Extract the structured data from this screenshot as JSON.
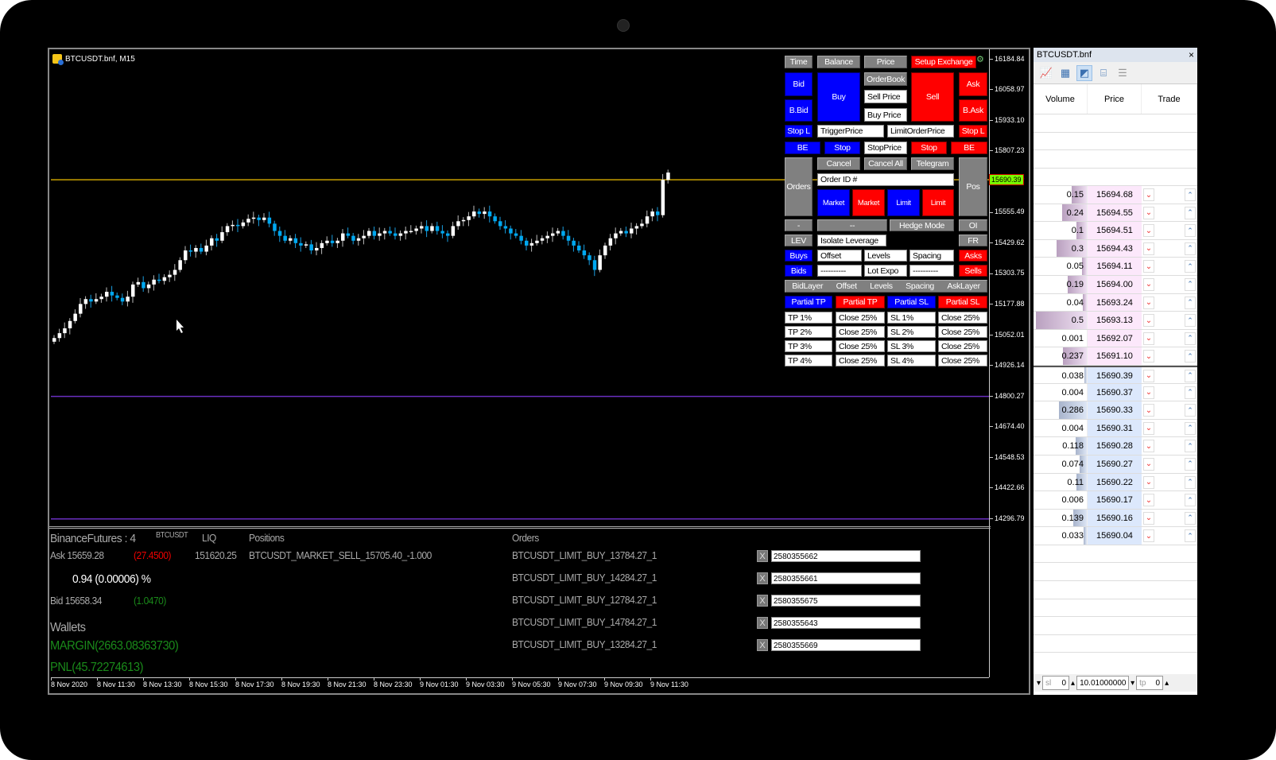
{
  "window": {
    "title": "BTCUSDT.bnf, M15"
  },
  "chart_data": {
    "type": "candlestick",
    "symbol": "BTCUSDT.bnf",
    "timeframe": "M15",
    "y_ticks": [
      "16184.84",
      "16058.97",
      "15933.10",
      "15807.23",
      "15690.39",
      "15555.49",
      "15429.62",
      "15303.75",
      "15177.88",
      "15052.01",
      "14926.14",
      "14800.27",
      "14674.40",
      "14548.53",
      "14422.66",
      "14296.79"
    ],
    "ylim": [
      14260,
      16220
    ],
    "current_price": "15690.39",
    "x_ticks": [
      "8 Nov 2020",
      "8 Nov 11:30",
      "8 Nov 13:30",
      "8 Nov 15:30",
      "8 Nov 17:30",
      "8 Nov 19:30",
      "8 Nov 21:30",
      "8 Nov 23:30",
      "9 Nov 01:30",
      "9 Nov 03:30",
      "9 Nov 05:30",
      "9 Nov 07:30",
      "9 Nov 09:30",
      "9 Nov 11:30"
    ],
    "hlines": [
      {
        "price": 15690.39,
        "color": "#c8a000"
      },
      {
        "price": 14800.27,
        "color": "#6a2fc0"
      },
      {
        "price": 14296.79,
        "color": "#6a2fc0"
      }
    ],
    "candles_close": [
      15040,
      15060,
      15080,
      15110,
      15140,
      15180,
      15200,
      15190,
      15200,
      15210,
      15230,
      15215,
      15205,
      15190,
      15210,
      15260,
      15270,
      15245,
      15260,
      15280,
      15275,
      15290,
      15300,
      15320,
      15360,
      15400,
      15395,
      15410,
      15395,
      15420,
      15450,
      15440,
      15475,
      15500,
      15505,
      15500,
      15515,
      15530,
      15535,
      15525,
      15535,
      15510,
      15480,
      15460,
      15440,
      15450,
      15430,
      15420,
      15425,
      15400,
      15410,
      15430,
      15440,
      15430,
      15440,
      15470,
      15460,
      15440,
      15450,
      15460,
      15480,
      15460,
      15470,
      15480,
      15470,
      15460,
      15470,
      15480,
      15480,
      15490,
      15500,
      15480,
      15500,
      15480,
      15470,
      15460,
      15500,
      15520,
      15525,
      15540,
      15560,
      15550,
      15560,
      15540,
      15520,
      15500,
      15490,
      15470,
      15460,
      15440,
      15420,
      15430,
      15440,
      15450,
      15460,
      15470,
      15480,
      15460,
      15440,
      15420,
      15400,
      15380,
      15360,
      15320,
      15380,
      15420,
      15450,
      15470,
      15480,
      15470,
      15490,
      15500,
      15510,
      15540,
      15560,
      15545,
      15690,
      15720
    ]
  },
  "panel": {
    "top_row": [
      "Time",
      "Balance",
      "Price",
      "Setup Exchange"
    ],
    "bid": "Bid",
    "bbid": "B.Bid",
    "buy": "Buy",
    "orderbook": "OrderBook",
    "sell_price": "Sell Price",
    "buy_price": "Buy Price",
    "sell": "Sell",
    "ask": "Ask",
    "bask": "B.Ask",
    "stopl_left": "Stop L",
    "trigger_price": "TriggerPrice",
    "limit_order_price": "LimitOrderPrice",
    "stopl_right": "Stop L",
    "be_left": "BE",
    "stop_blue": "Stop",
    "stop_price": "StopPrice",
    "stop_red": "Stop",
    "be_right": "BE",
    "orders": "Orders",
    "cancel": "Cancel",
    "cancel_all": "Cancel All",
    "telegram": "Telegram",
    "order_id": "Order ID #",
    "pos": "Pos",
    "market_buy": "Market",
    "market_sell": "Market",
    "limit_buy": "Limit",
    "limit_sell": "Limit",
    "minus": "-",
    "dashes": "--",
    "hedge_mode": "Hedge Mode",
    "oi": "OI",
    "lev": "LEV",
    "isolate_leverage": "Isolate Leverage",
    "fr": "FR",
    "buys": "Buys",
    "offset": "Offset",
    "levels": "Levels",
    "spacing": "Spacing",
    "asks": "Asks",
    "bids": "Bids",
    "blank1": "----------",
    "lot_expo": "Lot Expo",
    "blank2": "----------",
    "sells": "Sells",
    "layer_row": [
      "BidLayer",
      "Offset",
      "Levels",
      "Spacing",
      "AskLayer"
    ],
    "partial": [
      "Partial TP",
      "Partial TP",
      "Partial SL",
      "Partial SL"
    ],
    "tp_rows": [
      [
        "TP 1%",
        "Close 25%",
        "SL 1%",
        "Close 25%"
      ],
      [
        "TP 2%",
        "Close 25%",
        "SL 2%",
        "Close 25%"
      ],
      [
        "TP 3%",
        "Close 25%",
        "SL 3%",
        "Close 25%"
      ],
      [
        "TP 4%",
        "Close 25%",
        "SL 4%",
        "Close 25%"
      ]
    ]
  },
  "info": {
    "exchange": "BinanceFutures : 4",
    "symbol": "BTCUSDT",
    "liq_label": "LIQ",
    "positions_label": "Positions",
    "ask": "Ask 15659.28",
    "ask_change": "(27.4500)",
    "liq_value": "151620.25",
    "position": "BTCUSDT_MARKET_SELL_15705.40_-1.000",
    "spread": "0.94 (0.00006) %",
    "bid": "Bid 15658.34",
    "bid_change": "(1.0470)",
    "wallets": "Wallets",
    "margin": "MARGIN(2663.08363730)",
    "pnl": "PNL(45.72274613)",
    "orders_label": "Orders",
    "orders": [
      {
        "name": "BTCUSDT_LIMIT_BUY_13784.27_1",
        "id": "2580355662"
      },
      {
        "name": "BTCUSDT_LIMIT_BUY_14284.27_1",
        "id": "2580355661"
      },
      {
        "name": "BTCUSDT_LIMIT_BUY_12784.27_1",
        "id": "2580355675"
      },
      {
        "name": "BTCUSDT_LIMIT_BUY_14784.27_1",
        "id": "2580355643"
      },
      {
        "name": "BTCUSDT_LIMIT_BUY_13284.27_1",
        "id": "2580355669"
      }
    ],
    "x_label": "X"
  },
  "dom": {
    "title": "BTCUSDT.bnf",
    "close": "×",
    "headers": [
      "Volume",
      "Price",
      "Trade"
    ],
    "asks": [
      {
        "vol": "0.15",
        "price": "15694.68",
        "frac": 0.3
      },
      {
        "vol": "0.24",
        "price": "15694.55",
        "frac": 0.48
      },
      {
        "vol": "0.1",
        "price": "15694.51",
        "frac": 0.2
      },
      {
        "vol": "0.3",
        "price": "15694.43",
        "frac": 0.6
      },
      {
        "vol": "0.05",
        "price": "15694.11",
        "frac": 0.1
      },
      {
        "vol": "0.19",
        "price": "15694.00",
        "frac": 0.38
      },
      {
        "vol": "0.04",
        "price": "15693.24",
        "frac": 0.08
      },
      {
        "vol": "0.5",
        "price": "15693.13",
        "frac": 1.0
      },
      {
        "vol": "0.001",
        "price": "15692.07",
        "frac": 0.0
      },
      {
        "vol": "0.237",
        "price": "15691.10",
        "frac": 0.47
      }
    ],
    "bids": [
      {
        "vol": "0.038",
        "price": "15690.39",
        "frac": 0.05
      },
      {
        "vol": "0.004",
        "price": "15690.37",
        "frac": 0.0
      },
      {
        "vol": "0.286",
        "price": "15690.33",
        "frac": 0.55
      },
      {
        "vol": "0.004",
        "price": "15690.31",
        "frac": 0.0
      },
      {
        "vol": "0.118",
        "price": "15690.28",
        "frac": 0.22
      },
      {
        "vol": "0.074",
        "price": "15690.27",
        "frac": 0.14
      },
      {
        "vol": "0.11",
        "price": "15690.22",
        "frac": 0.21
      },
      {
        "vol": "0.006",
        "price": "15690.17",
        "frac": 0.0
      },
      {
        "vol": "0.139",
        "price": "15690.16",
        "frac": 0.27
      },
      {
        "vol": "0.033",
        "price": "15690.04",
        "frac": 0.06
      }
    ],
    "footer": {
      "sl_label": "sl",
      "sl_value": "0",
      "lot": "10.01000000",
      "tp_label": "tp",
      "tp_value": "0"
    }
  }
}
